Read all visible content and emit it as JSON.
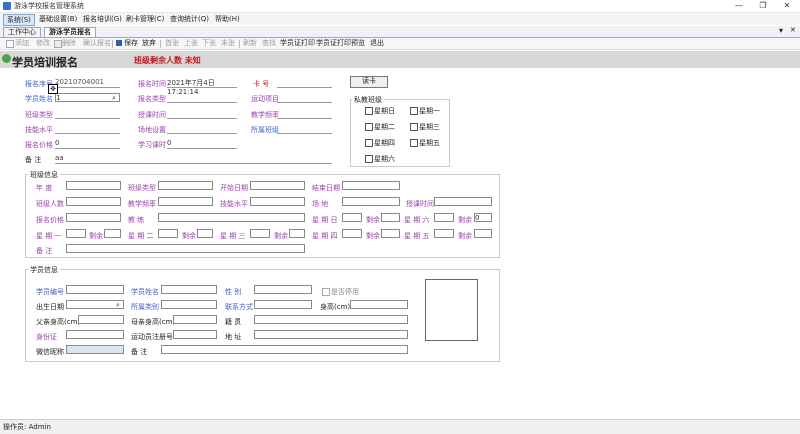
{
  "window": {
    "title": "游泳学校报名管理系统",
    "minimize": "—",
    "maximize": "❐",
    "close": "✕"
  },
  "menu": [
    "系统(S)",
    "基础设置(B)",
    "报名培训(G)",
    "刷卡管理(C)",
    "查询统计(Q)",
    "帮助(H)"
  ],
  "tabs": [
    "工作中心",
    "游泳学员报名"
  ],
  "tab_controls": {
    "dropdown": "▾",
    "close": "✕"
  },
  "toolbar": [
    "添加",
    "修改",
    "删除",
    "确认报名",
    "保存",
    "放弃",
    "首张",
    "上张",
    "下张",
    "末张",
    "刷新",
    "查找",
    "学员证打印",
    "学员证打印预览",
    "退出"
  ],
  "banner": {
    "title": "学员培训报名",
    "message": "班级剩余人数 未知"
  },
  "top_form": {
    "signup_no_label": "报名序号",
    "signup_no": "20210704001",
    "signup_time_label": "报名时间",
    "signup_time": "2021年7月4日 17:21:14",
    "card_label": "卡 号",
    "read_card": "读卡",
    "student_name_label": "学员姓名",
    "student_name": "1",
    "signup_type_label": "报名类型",
    "sport_label": "运动项目",
    "class_type_label": "班级类型",
    "train_time_label": "授课时间",
    "frequency_label": "教学频率",
    "skill_label": "技能水平",
    "venue_label": "场地设置",
    "class_label": "所属班级",
    "price_label": "报名价格",
    "price": "0",
    "period_label": "学习课时",
    "period": "0",
    "remark_label": "备 注",
    "remark": "aa",
    "private_title": "私教班级",
    "weekdays": [
      "星期日",
      "星期一",
      "星期二",
      "星期三",
      "星期四",
      "星期五",
      "星期六"
    ]
  },
  "class_info": {
    "title": "班级信息",
    "row1": [
      "年 度",
      "班级类型",
      "开始日期",
      "结束日期"
    ],
    "row2": [
      "班级人数",
      "教学频率",
      "技能水平",
      "场 地",
      "授课时间"
    ],
    "row3": [
      "报名价格",
      "教 练",
      "星 期 日",
      "剩余",
      "星 期 六",
      "剩余"
    ],
    "row3_value": "0",
    "row4": [
      "星 期 一",
      "剩余",
      "星 期 二",
      "剩余",
      "星 期 三",
      "剩余",
      "星 期 四",
      "剩余",
      "星 期 五",
      "剩余"
    ],
    "remark": "备 注"
  },
  "student_info": {
    "title": "学员信息",
    "id_label": "学员编号",
    "name_label": "学员姓名",
    "gender_label": "性 别",
    "disabled_label": "是否停用",
    "birthday_label": "出生日期",
    "category_label": "所属类别",
    "contact_label": "联系方式",
    "height_label": "身高(cm)",
    "father_label": "父亲身高(cm)",
    "mother_label": "母亲身高(cm)",
    "native_label": "籍 贯",
    "idcard_label": "身份证",
    "athlete_label": "运动员注册号",
    "address_label": "地 址",
    "wechat_label": "微信昵称",
    "remark_label": "备 注"
  },
  "status": {
    "text": "操作员: Admin"
  }
}
